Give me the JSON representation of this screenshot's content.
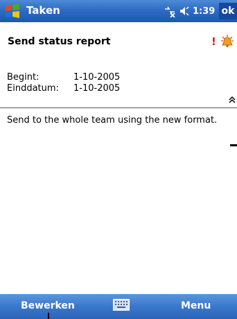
{
  "titlebar": {
    "title": "Taken",
    "time": "1:39",
    "ok_label": "ok",
    "icons": [
      "windows-start-icon",
      "connectivity-icon",
      "volume-icon"
    ]
  },
  "task": {
    "title": "Send status report",
    "priority_mark": "!",
    "start_label": "Begint:",
    "start_value": "1-10-2005",
    "end_label": "Einddatum:",
    "end_value": "1-10-2005"
  },
  "notes": {
    "text": "Send to the whole team using the new format."
  },
  "menubar": {
    "left_label": "Bewerken",
    "right_label": "Menu"
  },
  "colors": {
    "bar_blue": "#2f6cc4",
    "priority_red": "#d02010"
  }
}
